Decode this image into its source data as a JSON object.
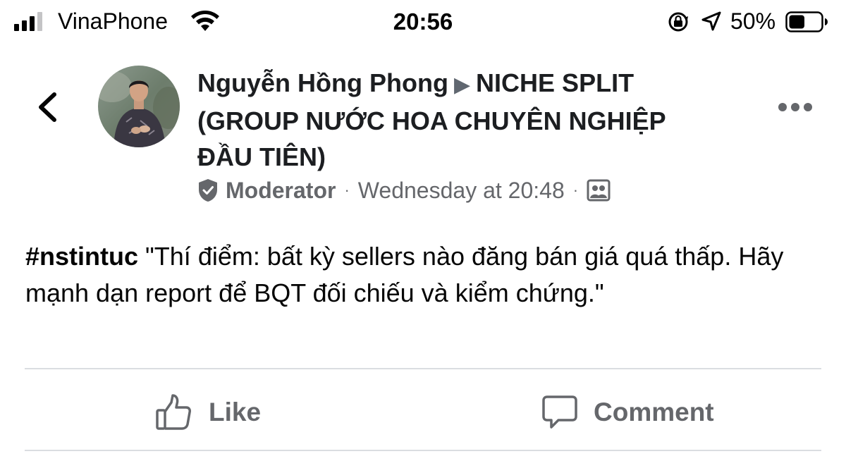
{
  "status_bar": {
    "carrier": "VinaPhone",
    "time": "20:56",
    "battery_percent": "50%",
    "signal_bars_active": 3,
    "battery_level": 0.5,
    "icons": [
      "signal-icon",
      "wifi-icon",
      "rotation-lock-icon",
      "location-icon",
      "battery-icon"
    ]
  },
  "header": {
    "back_icon": "chevron-left-icon",
    "author": "Nguyễn Hồng Phong",
    "arrow": "▶",
    "group_line1": "NICHE SPLIT",
    "group_line2": "(GROUP NƯỚC HOA CHUYÊN NGHIỆP",
    "group_line3": "ĐẦU TIÊN)",
    "more_icon": "more-dots-icon"
  },
  "meta": {
    "role": "Moderator",
    "separator": "·",
    "timestamp": "Wednesday at 20:48",
    "audience_icon": "group-members-icon"
  },
  "post": {
    "hashtag": "#nstintuc",
    "body": " \"Thí điểm: bất kỳ sellers nào đăng bán giá quá thấp. Hãy mạnh dạn report để BQT đối chiếu và kiểm chứng.\""
  },
  "actions": {
    "like_label": "Like",
    "comment_label": "Comment"
  },
  "colors": {
    "secondary_text": "#65676b",
    "divider": "#dadde1",
    "primary_text": "#050505"
  }
}
